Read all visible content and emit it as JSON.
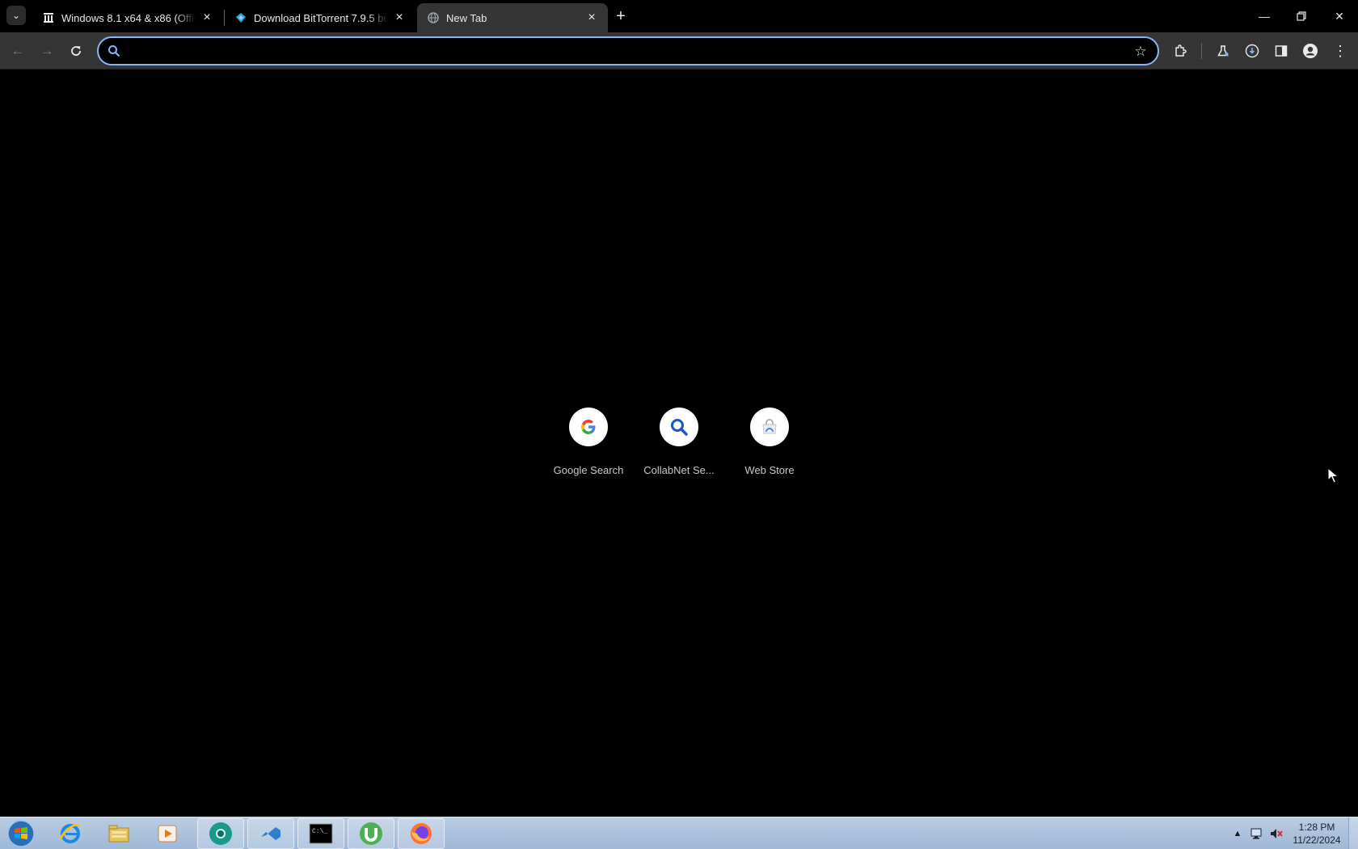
{
  "browser": {
    "tabs": [
      {
        "title": "Windows 8.1 x64 & x86 (Offici",
        "favicon": "archive-icon",
        "active": false
      },
      {
        "title": "Download BitTorrent 7.9.5 buil",
        "favicon": "softonic-icon",
        "active": false
      },
      {
        "title": "New Tab",
        "favicon": "globe-icon",
        "active": true
      }
    ],
    "omnibox": {
      "value": "",
      "placeholder": ""
    }
  },
  "shortcuts": [
    {
      "label": "Google Search",
      "icon": "google-icon"
    },
    {
      "label": "CollabNet Se...",
      "icon": "search-icon"
    },
    {
      "label": "Web Store",
      "icon": "web-store-icon"
    }
  ],
  "taskbar": {
    "clock": {
      "time": "1:28 PM",
      "date": "11/22/2024"
    },
    "apps": [
      "internet-explorer-icon",
      "file-explorer-icon",
      "media-player-icon",
      "chrome-icon",
      "visual-studio-icon",
      "cmd-icon",
      "utorrent-icon",
      "firefox-icon"
    ]
  },
  "colors": {
    "accent": "#8ab4f8",
    "toolbar": "#353535",
    "background": "#000000"
  }
}
